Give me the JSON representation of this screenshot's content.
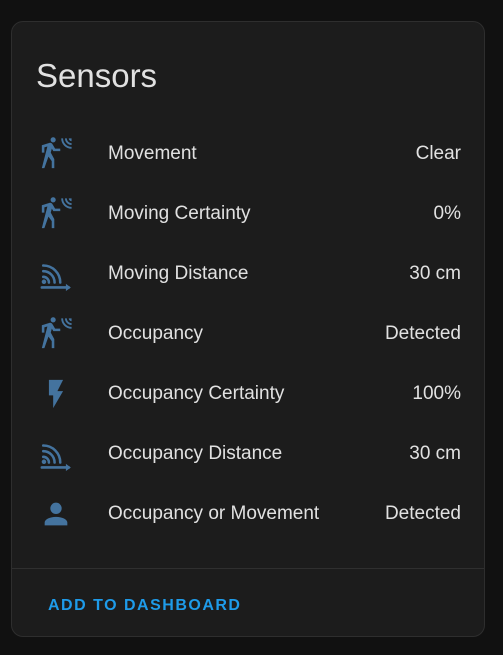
{
  "card": {
    "title": "Sensors",
    "icon_color": "#44739e"
  },
  "rows": [
    {
      "icon": "motion-sensor-icon",
      "label": "Movement",
      "value": "Clear"
    },
    {
      "icon": "motion-sensor-icon",
      "label": "Moving Certainty",
      "value": "0%"
    },
    {
      "icon": "signal-distance-icon",
      "label": "Moving Distance",
      "value": "30 cm"
    },
    {
      "icon": "motion-sensor-icon",
      "label": "Occupancy",
      "value": "Detected"
    },
    {
      "icon": "flash-icon",
      "label": "Occupancy Certainty",
      "value": "100%"
    },
    {
      "icon": "signal-distance-icon",
      "label": "Occupancy Distance",
      "value": "30 cm"
    },
    {
      "icon": "person-icon",
      "label": "Occupancy or Movement",
      "value": "Detected"
    }
  ],
  "footer": {
    "button_label": "ADD TO DASHBOARD",
    "button_color": "#1e9be9"
  }
}
